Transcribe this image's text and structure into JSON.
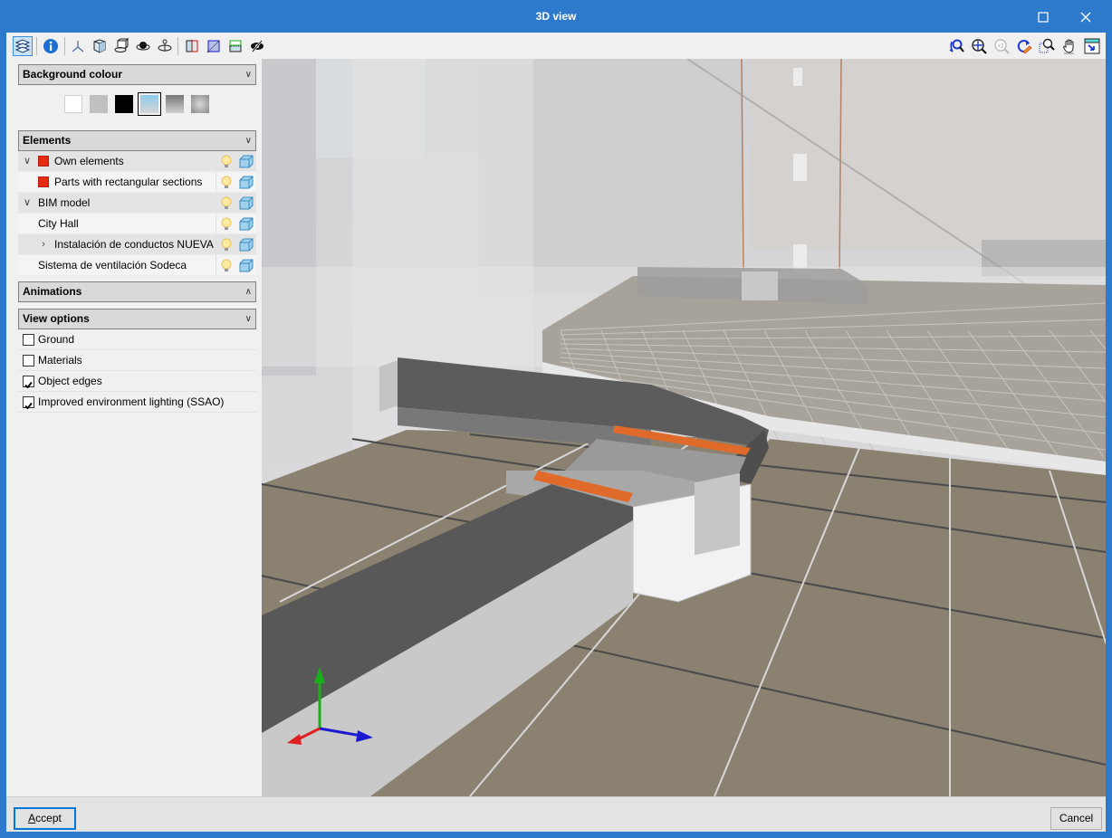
{
  "window": {
    "title": "3D view",
    "maximize_icon": "maximize-icon",
    "close_icon": "close-icon"
  },
  "toolbar": {
    "left_tools": [
      {
        "name": "layers-icon",
        "tooltip": "Panel",
        "active": true
      },
      {
        "name": "info-icon"
      },
      {
        "name": "axes-icon"
      },
      {
        "name": "shaded-solid-icon"
      },
      {
        "name": "orbit-object-icon"
      },
      {
        "name": "orbit-eye-icon"
      },
      {
        "name": "orbit-vertical-icon"
      },
      {
        "name": "clipping-plane-red-icon"
      },
      {
        "name": "clipping-plane-blue-icon"
      },
      {
        "name": "clipping-plane-green-icon"
      },
      {
        "name": "hide-icon"
      }
    ],
    "right_tools": [
      {
        "name": "previous-view-icon"
      },
      {
        "name": "zoom-extents-icon"
      },
      {
        "name": "zoom-x2-icon",
        "disabled": true
      },
      {
        "name": "redraw-icon"
      },
      {
        "name": "zoom-window-icon"
      },
      {
        "name": "pan-hand-icon"
      },
      {
        "name": "new-window-icon"
      }
    ]
  },
  "panel": {
    "background": {
      "header": "Background colour",
      "swatches": [
        {
          "name": "white",
          "color": "#ffffff",
          "selected": false
        },
        {
          "name": "light-grey",
          "color": "#c0c0c0",
          "selected": false
        },
        {
          "name": "black",
          "color": "#000000",
          "selected": false
        },
        {
          "name": "sky-gradient",
          "color_top": "#8ecbec",
          "color_bottom": "#d5d5d5",
          "selected": true
        },
        {
          "name": "grey-gradient",
          "color_top": "#777777",
          "color_bottom": "#d0d0d0",
          "selected": false
        },
        {
          "name": "radial-grey",
          "color_center": "#d8d8d8",
          "color_edge": "#8a8a8a",
          "selected": false
        }
      ]
    },
    "elements": {
      "header": "Elements",
      "rows": [
        {
          "label": "Own elements",
          "level": 0,
          "expander": "expanded",
          "color": "#e52b12"
        },
        {
          "label": "Parts with rectangular sections",
          "level": 1,
          "expander": "none",
          "color": "#e52b12"
        },
        {
          "label": "BIM model",
          "level": 0,
          "expander": "expanded"
        },
        {
          "label": "City Hall",
          "level": 1,
          "expander": "none"
        },
        {
          "label": "Instalación de conductos NUEVA",
          "level": 1,
          "expander": "collapsed"
        },
        {
          "label": "Sistema de ventilación Sodeca",
          "level": 1,
          "expander": "none"
        }
      ]
    },
    "animations": {
      "header": "Animations",
      "state": "collapsed"
    },
    "view_options": {
      "header": "View options",
      "options": [
        {
          "label": "Ground",
          "checked": false
        },
        {
          "label": "Materials",
          "checked": false
        },
        {
          "label": "Object edges",
          "checked": true
        },
        {
          "label": "Improved environment lighting (SSAO)",
          "checked": true
        }
      ]
    }
  },
  "footer": {
    "accept_label": "Accept",
    "accept_accel": "A",
    "cancel_label": "Cancel"
  },
  "colors": {
    "title_bar": "#2d7acc",
    "duct_top": "#5b5b5b",
    "duct_side": "#c9c9c9",
    "flange": "#e06a2a",
    "floor": "#8c8270",
    "axis_x": "#1a1ad0",
    "axis_y": "#1ab01a",
    "axis_z": "#e02020"
  }
}
